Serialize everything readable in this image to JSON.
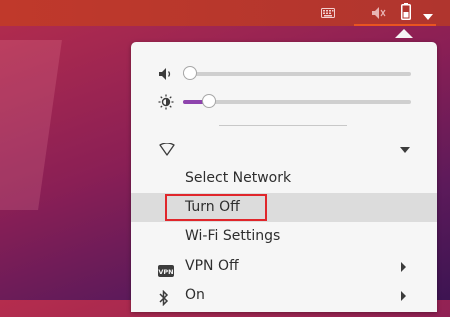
{
  "topbar": {
    "icons": [
      "keyboard-icon",
      "volume-muted-icon",
      "battery-icon",
      "dropdown-arrow-icon"
    ]
  },
  "system_menu": {
    "volume": {
      "icon": "speaker-icon",
      "level": 0.0
    },
    "brightness": {
      "icon": "brightness-icon",
      "level": 0.09
    },
    "wifi": {
      "icon": "wifi-icon",
      "expanded": true
    },
    "wifi_submenu": {
      "items": [
        {
          "label": "Select Network"
        },
        {
          "label": "Turn Off"
        },
        {
          "label": "Wi-Fi Settings"
        }
      ]
    },
    "vpn": {
      "label": "VPN Off",
      "icon": "vpn-icon"
    },
    "bluetooth": {
      "label": "On",
      "icon": "bluetooth-icon"
    }
  },
  "colors": {
    "accent": "#e95420",
    "slider_fill": "#8e44ad",
    "highlight_box": "#e0262b"
  }
}
